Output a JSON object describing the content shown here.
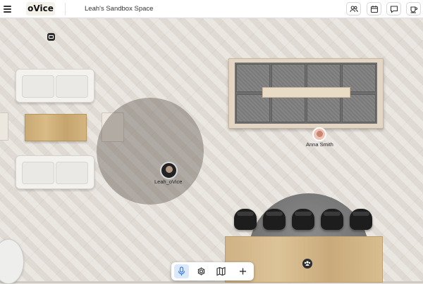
{
  "header": {
    "logo": "oVice",
    "space_title": "Leah's Sandbox Space",
    "icons": [
      "members-icon",
      "calendar-icon",
      "chat-icon",
      "coffee-icon"
    ]
  },
  "users": [
    {
      "name": "Anna Smith"
    },
    {
      "name": "Leah_oVice"
    }
  ],
  "toolbar": {
    "buttons": [
      "microphone-icon",
      "settings-icon",
      "map-icon",
      "plus-icon"
    ],
    "active": "microphone-icon"
  },
  "colors": {
    "accent": "#2f7cf6",
    "meeting_area": "#5f5850"
  }
}
